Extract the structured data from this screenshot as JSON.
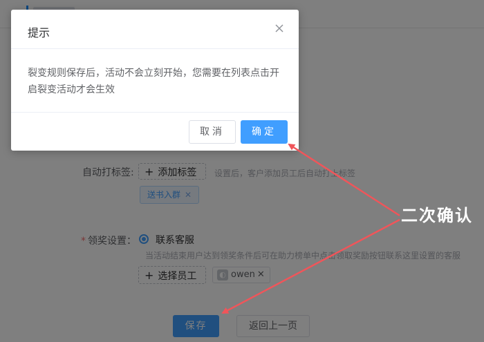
{
  "form": {
    "auto_tag_label": "自动打标签:",
    "add_tag_button": "添加标签",
    "auto_tag_hint": "设置后，客户添加员工后自动打上标签",
    "tag_value": "送书入群",
    "reward_required": "*",
    "reward_label": "领奖设置：",
    "reward_option": "联系客服",
    "reward_hint": "当活动结束用户达到领奖条件后可在助力榜单中点击领取奖励按钮联系这里设置的客服",
    "select_staff_button": "选择员工",
    "staff_name": "owen",
    "save_button": "保存",
    "back_button": "返回上一页"
  },
  "dialog": {
    "title": "提示",
    "message": "裂变规则保存后，活动不会立刻开始，您需要在列表点击开启裂变活动才会生效",
    "cancel_button": "取消",
    "confirm_button": "确定"
  },
  "annotation": {
    "text": "二次确认",
    "color": "#f0555a"
  },
  "colors": {
    "primary": "#409eff",
    "overlay": "rgba(0,0,0,0.5)"
  }
}
